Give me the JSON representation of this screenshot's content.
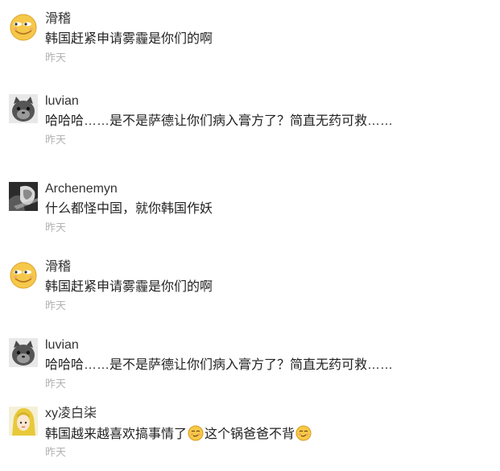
{
  "comments": [
    {
      "avatar": "smiley-face-avatar",
      "username": "滑稽",
      "text": "韩国赶紧申请雾霾是你们的啊",
      "time": "昨天"
    },
    {
      "avatar": "gray-cat-avatar",
      "username": "luvian",
      "text": "哈哈哈……是不是萨德让你们病入膏方了？简直无药可救……",
      "time": "昨天"
    },
    {
      "avatar": "dark-portrait-avatar",
      "username": "Archenemyn",
      "text": "什么都怪中国，就你韩国作妖",
      "time": "昨天"
    },
    {
      "avatar": "smiley-face-avatar",
      "username": "滑稽",
      "text": "韩国赶紧申请雾霾是你们的啊",
      "time": "昨天"
    },
    {
      "avatar": "gray-cat-avatar",
      "username": "luvian",
      "text": "哈哈哈……是不是萨德让你们病入膏方了？简直无药可救……",
      "time": "昨天"
    },
    {
      "avatar": "blonde-anime-avatar",
      "username": "xy凌白柒",
      "text_part1": "韩国越来越喜欢搞事情了",
      "text_part2": "这个锅爸爸不背",
      "emoji": "smirk-emoji-icon",
      "time": "昨天"
    }
  ]
}
